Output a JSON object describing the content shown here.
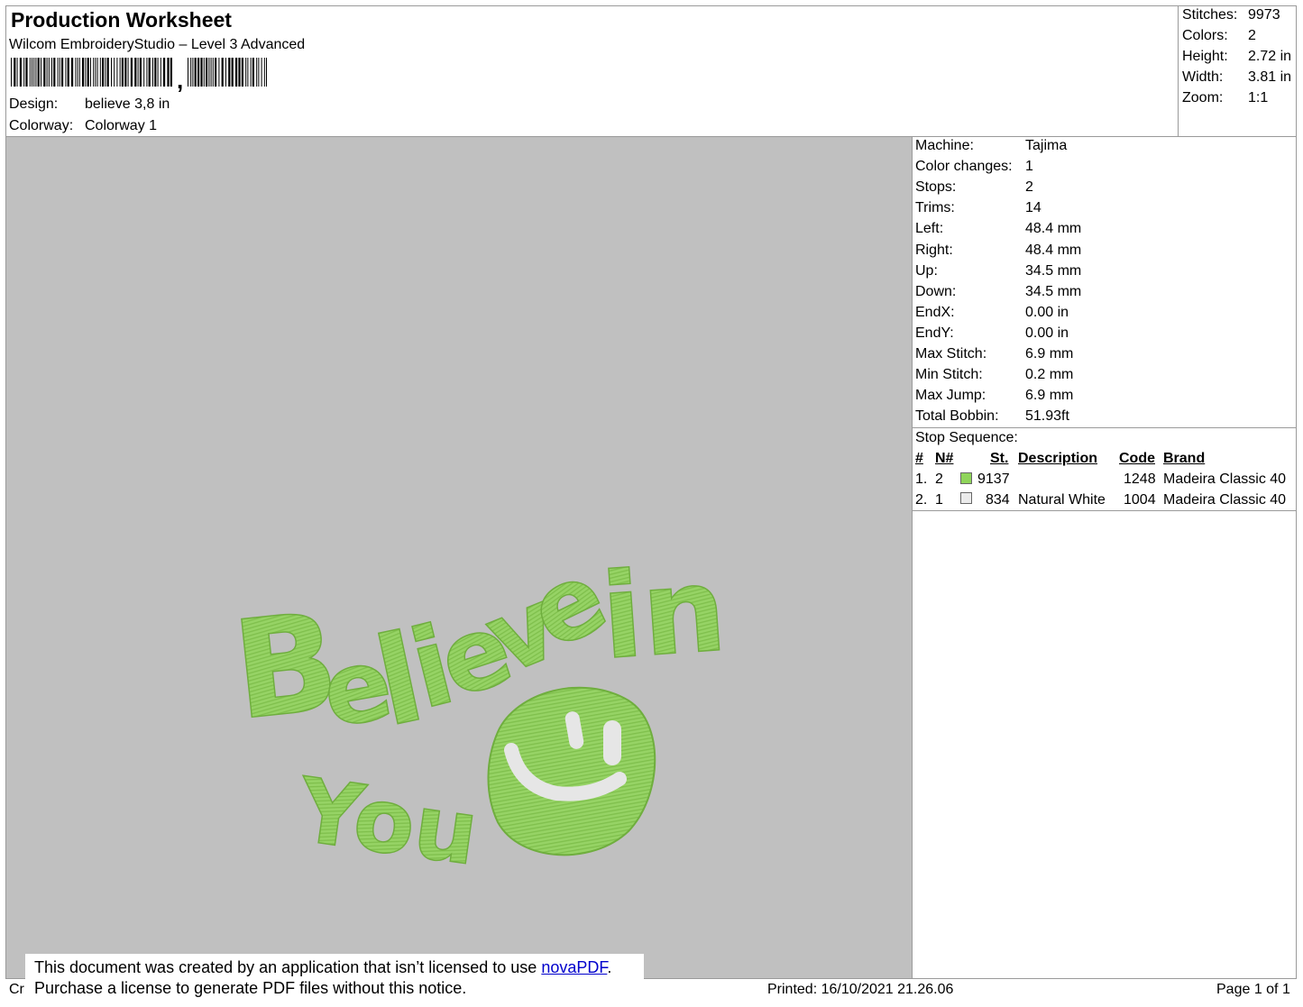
{
  "header": {
    "title": "Production Worksheet",
    "software": "Wilcom EmbroideryStudio – Level 3 Advanced",
    "design_label": "Design:",
    "design_value": "believe 3,8 in",
    "colorway_label": "Colorway:",
    "colorway_value": "Colorway 1"
  },
  "stats": [
    {
      "label": "Stitches:",
      "value": "9973"
    },
    {
      "label": "Colors:",
      "value": "2"
    },
    {
      "label": "Height:",
      "value": "2.72 in"
    },
    {
      "label": "Width:",
      "value": "3.81 in"
    },
    {
      "label": "Zoom:",
      "value": "1:1"
    }
  ],
  "machine_info": [
    {
      "label": "Machine:",
      "value": "Tajima"
    },
    {
      "label": "Color changes:",
      "value": "1"
    },
    {
      "label": "Stops:",
      "value": "2"
    },
    {
      "label": "Trims:",
      "value": "14"
    },
    {
      "label": "Left:",
      "value": "48.4 mm"
    },
    {
      "label": "Right:",
      "value": "48.4 mm"
    },
    {
      "label": "Up:",
      "value": "34.5 mm"
    },
    {
      "label": "Down:",
      "value": "34.5 mm"
    },
    {
      "label": "EndX:",
      "value": "0.00 in"
    },
    {
      "label": "EndY:",
      "value": "0.00 in"
    },
    {
      "label": "Max Stitch:",
      "value": "6.9 mm"
    },
    {
      "label": "Min Stitch:",
      "value": "0.2 mm"
    },
    {
      "label": "Max Jump:",
      "value": "6.9 mm"
    },
    {
      "label": "Total Bobbin:",
      "value": "51.93ft"
    }
  ],
  "stop_sequence": {
    "title": "Stop Sequence:",
    "headers": {
      "num": "#",
      "n": "N#",
      "st": "St.",
      "description": "Description",
      "code": "Code",
      "brand": "Brand"
    },
    "rows": [
      {
        "num": "1.",
        "n": "2",
        "color": "#8fd45a",
        "st": "9137",
        "description": "",
        "code": "1248",
        "brand": "Madeira Classic 40"
      },
      {
        "num": "2.",
        "n": "1",
        "color": "#ebebeb",
        "st": "834",
        "description": "Natural White",
        "code": "1004",
        "brand": "Madeira Classic 40"
      }
    ]
  },
  "design_preview": {
    "text_line1": "Believe in",
    "text_line2": "You",
    "thread_color": "#96d365",
    "accent_color": "#e6e6e6",
    "background": "#c0c0c0"
  },
  "notice": {
    "line1_pre": "This document was created by an application that isn’t licensed to use ",
    "line1_link": "novaPDF",
    "line1_post": ".",
    "line2": "Purchase a license to generate PDF files without this notice."
  },
  "footer": {
    "left_fragment": "Cr",
    "printed": "Printed: 16/10/2021 21.26.06",
    "page": "Page 1 of 1"
  }
}
